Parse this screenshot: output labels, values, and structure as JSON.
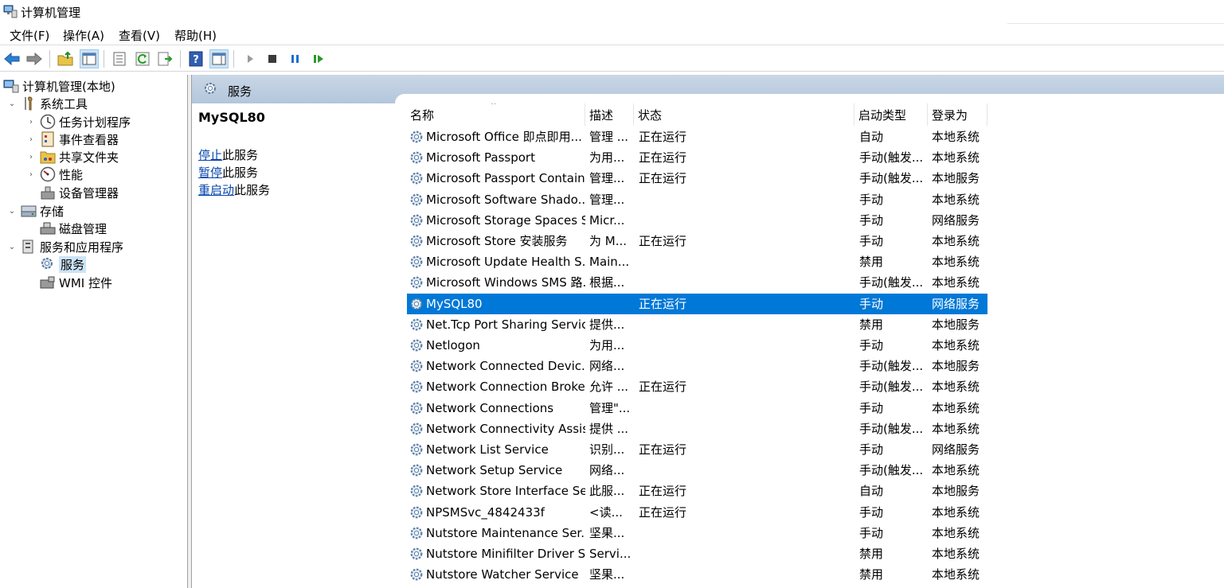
{
  "window": {
    "title": "计算机管理"
  },
  "menu": [
    "文件(F)",
    "操作(A)",
    "查看(V)",
    "帮助(H)"
  ],
  "tree": [
    {
      "label": "计算机管理(本地)",
      "level": 0,
      "icon": "computer-management-icon"
    },
    {
      "label": "系统工具",
      "level": 1,
      "icon": "system-tools-icon",
      "expander": "⌄"
    },
    {
      "label": "任务计划程序",
      "level": 2,
      "icon": "clock-icon",
      "expander": "›"
    },
    {
      "label": "事件查看器",
      "level": 2,
      "icon": "event-viewer-icon",
      "expander": "›"
    },
    {
      "label": "共享文件夹",
      "level": 2,
      "icon": "shared-folder-icon",
      "expander": "›"
    },
    {
      "label": "性能",
      "level": 2,
      "icon": "performance-icon",
      "expander": "›"
    },
    {
      "label": "设备管理器",
      "level": 2,
      "icon": "device-manager-icon"
    },
    {
      "label": "存储",
      "level": 1,
      "icon": "storage-icon",
      "expander": "⌄"
    },
    {
      "label": "磁盘管理",
      "level": 2,
      "icon": "disk-management-icon"
    },
    {
      "label": "服务和应用程序",
      "level": 1,
      "icon": "services-apps-icon",
      "expander": "⌄"
    },
    {
      "label": "服务",
      "level": 2,
      "icon": "services-gear-icon",
      "selected": true
    },
    {
      "label": "WMI 控件",
      "level": 2,
      "icon": "wmi-control-icon"
    }
  ],
  "pane": {
    "header": "服务",
    "selected_service": "MySQL80",
    "actions": [
      {
        "link": "停止",
        "rest": "此服务"
      },
      {
        "link": "暂停",
        "rest": "此服务"
      },
      {
        "link": "重启动",
        "rest": "此服务"
      }
    ]
  },
  "columns": [
    "名称",
    "描述",
    "状态",
    "启动类型",
    "登录为"
  ],
  "services": [
    [
      "Microsoft Office 即点即用...",
      "管理 ...",
      "正在运行",
      "自动",
      "本地系统"
    ],
    [
      "Microsoft Passport",
      "为用...",
      "正在运行",
      "手动(触发...",
      "本地系统"
    ],
    [
      "Microsoft Passport Container",
      "管理...",
      "正在运行",
      "手动(触发...",
      "本地服务"
    ],
    [
      "Microsoft Software Shado...",
      "管理...",
      "",
      "手动",
      "本地系统"
    ],
    [
      "Microsoft Storage Spaces S...",
      "Micr...",
      "",
      "手动",
      "网络服务"
    ],
    [
      "Microsoft Store 安装服务",
      "为 M...",
      "正在运行",
      "手动",
      "本地系统"
    ],
    [
      "Microsoft Update Health S...",
      "Main...",
      "",
      "禁用",
      "本地系统"
    ],
    [
      "Microsoft Windows SMS 路...",
      "根据...",
      "",
      "手动(触发...",
      "本地系统"
    ],
    [
      "MySQL80",
      "",
      "正在运行",
      "手动",
      "网络服务"
    ],
    [
      "Net.Tcp Port Sharing Service",
      "提供...",
      "",
      "禁用",
      "本地服务"
    ],
    [
      "Netlogon",
      "为用...",
      "",
      "手动",
      "本地系统"
    ],
    [
      "Network Connected Devic...",
      "网络...",
      "",
      "手动(触发...",
      "本地服务"
    ],
    [
      "Network Connection Broker",
      "允许 ...",
      "正在运行",
      "手动(触发...",
      "本地系统"
    ],
    [
      "Network Connections",
      "管理\"...",
      "",
      "手动",
      "本地系统"
    ],
    [
      "Network Connectivity Assis...",
      "提供 ...",
      "",
      "手动(触发...",
      "本地系统"
    ],
    [
      "Network List Service",
      "识别...",
      "正在运行",
      "手动",
      "网络服务"
    ],
    [
      "Network Setup Service",
      "网络...",
      "",
      "手动(触发...",
      "本地系统"
    ],
    [
      "Network Store Interface Se...",
      "此服...",
      "正在运行",
      "自动",
      "本地服务"
    ],
    [
      "NPSMSvc_4842433f",
      "<读...",
      "正在运行",
      "手动",
      "本地系统"
    ],
    [
      "Nutstore Maintenance Ser...",
      "坚果...",
      "",
      "手动",
      "本地系统"
    ],
    [
      "Nutstore Minifilter Driver S...",
      "Servi...",
      "",
      "禁用",
      "本地系统"
    ],
    [
      "Nutstore Watcher Service",
      "坚果...",
      "",
      "禁用",
      "本地系统"
    ]
  ],
  "selected_index": 8,
  "colors": {
    "selection": "#0078d7",
    "header_band": "#b3c6db",
    "link": "#0645ad"
  }
}
